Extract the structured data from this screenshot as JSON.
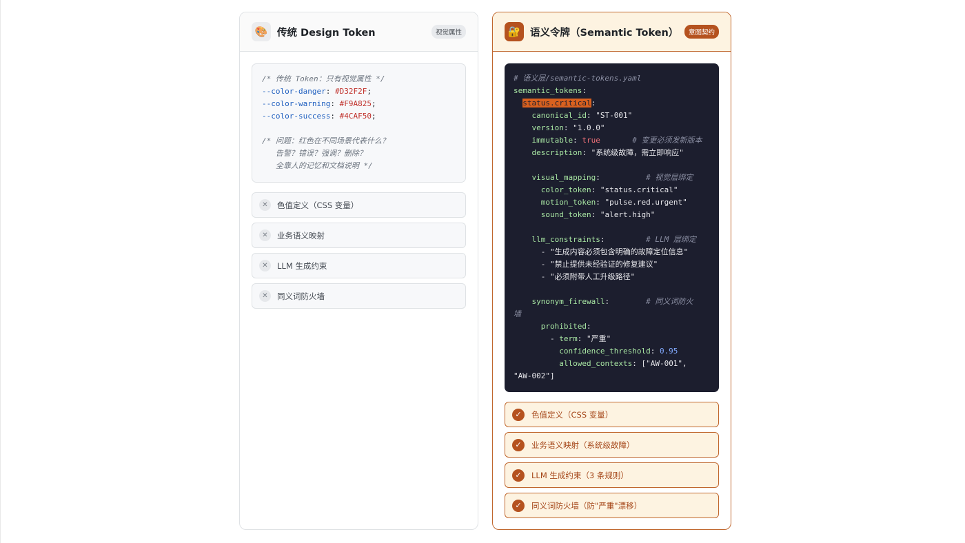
{
  "left_panel": {
    "icon": "palette-icon",
    "title": "传统 Design Token",
    "badge": "视觉属性",
    "code": {
      "l1": "/* 传统 Token：只有视觉属性 */",
      "l2_var": "--color-danger",
      "l2_val": "#D32F2F",
      "l3_var": "--color-warning",
      "l3_val": "#F9A825",
      "l4_var": "--color-success",
      "l4_val": "#4CAF50",
      "l6": "/* 问题：红色在不同场景代表什么？",
      "l7": "   告警？错误？强调？删除？",
      "l8": "   全靠人的记忆和文档说明 */"
    },
    "items": [
      {
        "label": "色值定义（CSS 变量）"
      },
      {
        "label": "业务语义映射"
      },
      {
        "label": "LLM 生成约束"
      },
      {
        "label": "同义词防火墙"
      }
    ]
  },
  "right_panel": {
    "icon": "contract-icon",
    "title": "语义令牌（Semantic Token）",
    "badge": "意图契约",
    "code": {
      "c1": "# 语义层/semantic-tokens.yaml",
      "k_root": "semantic_tokens",
      "k_status": "status.critical",
      "k_canon": "canonical_id",
      "v_canon": "\"ST-001\"",
      "k_version": "version",
      "v_version": "\"1.0.0\"",
      "k_immutable": "immutable",
      "v_immutable": "true",
      "c_immutable": "# 变更必须发新版本",
      "k_desc": "description",
      "v_desc": "\"系统级故障，需立即响应\"",
      "k_visual": "visual_mapping",
      "c_visual": "# 视觉层绑定",
      "k_color": "color_token",
      "v_color": "\"status.critical\"",
      "k_motion": "motion_token",
      "v_motion": "\"pulse.red.urgent\"",
      "k_sound": "sound_token",
      "v_sound": "\"alert.high\"",
      "k_llm": "llm_constraints",
      "c_llm": "# LLM 层绑定",
      "llm1": "\"生成内容必须包含明确的故障定位信息\"",
      "llm2": "\"禁止提供未经验证的修复建议\"",
      "llm3": "\"必须附带人工升级路径\"",
      "k_syn": "synonym_firewall",
      "c_syn_a": "# 同义词防火",
      "c_syn_b": "墙",
      "k_prohibited": "prohibited",
      "k_term": "term",
      "v_term": "\"严重\"",
      "k_conf": "confidence_threshold",
      "v_conf": "0.95",
      "k_allowed": "allowed_contexts",
      "v_allowed_a": "[\"AW-001\",",
      "v_allowed_b": "\"AW-002\"]"
    },
    "items": [
      {
        "label": "色值定义（CSS 变量）"
      },
      {
        "label": "业务语义映射（系统级故障）"
      },
      {
        "label": "LLM 生成约束（3 条规则）"
      },
      {
        "label": "同义词防火墙（防\"严重\"漂移）"
      }
    ]
  }
}
